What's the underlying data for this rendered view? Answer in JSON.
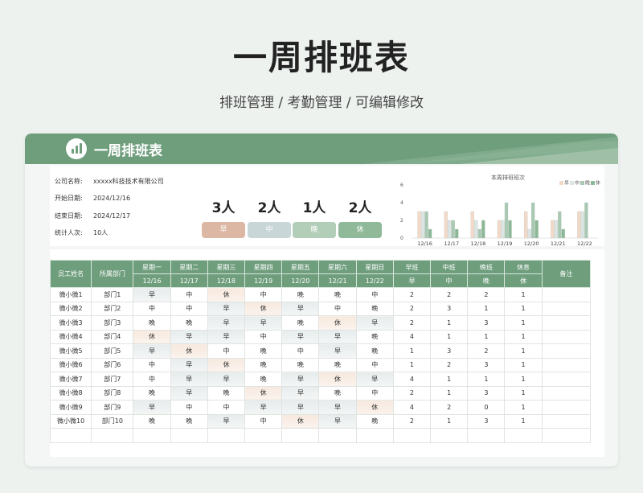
{
  "page": {
    "title": "一周排班表",
    "subtitle": "排班管理 / 考勤管理 / 可编辑修改"
  },
  "card": {
    "title": "一周排班表"
  },
  "info": {
    "company_label": "公司名称:",
    "company_value": "xxxxx科技技术有限公司",
    "start_label": "开始日期:",
    "start_value": "2024/12/16",
    "end_label": "结束日期:",
    "end_value": "2024/12/17",
    "count_label": "统计人次:",
    "count_value": "10人"
  },
  "stats": [
    {
      "value": "3人",
      "label": "早",
      "color": "#dcb7a4"
    },
    {
      "value": "2人",
      "label": "中",
      "color": "#c9d6d8"
    },
    {
      "value": "1人",
      "label": "晚",
      "color": "#b2cdb8"
    },
    {
      "value": "2人",
      "label": "休",
      "color": "#8fb999"
    }
  ],
  "chart_data": {
    "type": "bar",
    "title": "本周排班班次",
    "categories": [
      "12/16",
      "12/17",
      "12/18",
      "12/19",
      "12/20",
      "12/21",
      "12/22"
    ],
    "series": [
      {
        "name": "早",
        "color": "#f4d9c8",
        "values": [
          3,
          3,
          3,
          2,
          3,
          2,
          3
        ]
      },
      {
        "name": "中",
        "color": "#dce4e4",
        "values": [
          3,
          2,
          2,
          2,
          1,
          2,
          3
        ]
      },
      {
        "name": "晚",
        "color": "#a9c8b2",
        "values": [
          3,
          2,
          1,
          4,
          4,
          3,
          4
        ]
      },
      {
        "name": "休",
        "color": "#8db897",
        "values": [
          1,
          1,
          2,
          2,
          2,
          1,
          0
        ]
      }
    ],
    "ylim": [
      0,
      4
    ],
    "yticks": [
      0,
      2,
      4,
      6
    ],
    "legend": "top-right"
  },
  "table": {
    "headers": {
      "name": "员工姓名",
      "dept": "所属部门",
      "weekdays": [
        "星期一",
        "星期二",
        "星期三",
        "星期四",
        "星期五",
        "星期六",
        "星期日"
      ],
      "dates": [
        "12/16",
        "12/17",
        "12/18",
        "12/19",
        "12/20",
        "12/21",
        "12/22"
      ],
      "summary": [
        "早班",
        "中班",
        "晚班",
        "休息"
      ],
      "summary_sub": [
        "早",
        "中",
        "晚",
        "休"
      ],
      "note": "备注"
    },
    "rows": [
      {
        "name": "微小微1",
        "dept": "部门1",
        "shifts": [
          "早",
          "中",
          "休",
          "中",
          "晚",
          "晚",
          "中"
        ],
        "counts": [
          "2",
          "2",
          "2",
          "1"
        ],
        "note": ""
      },
      {
        "name": "微小微2",
        "dept": "部门2",
        "shifts": [
          "中",
          "中",
          "早",
          "休",
          "早",
          "中",
          "晚"
        ],
        "counts": [
          "2",
          "3",
          "1",
          "1"
        ],
        "note": ""
      },
      {
        "name": "微小微3",
        "dept": "部门3",
        "shifts": [
          "晚",
          "晚",
          "早",
          "早",
          "晚",
          "休",
          "早"
        ],
        "counts": [
          "2",
          "1",
          "3",
          "1"
        ],
        "note": ""
      },
      {
        "name": "微小微4",
        "dept": "部门4",
        "shifts": [
          "休",
          "早",
          "早",
          "中",
          "早",
          "早",
          "晚"
        ],
        "counts": [
          "4",
          "1",
          "1",
          "1"
        ],
        "note": ""
      },
      {
        "name": "微小微5",
        "dept": "部门5",
        "shifts": [
          "早",
          "休",
          "中",
          "晚",
          "中",
          "早",
          "晚"
        ],
        "counts": [
          "1",
          "3",
          "2",
          "1"
        ],
        "note": ""
      },
      {
        "name": "微小微6",
        "dept": "部门6",
        "shifts": [
          "中",
          "早",
          "休",
          "晚",
          "晚",
          "晚",
          "中"
        ],
        "counts": [
          "1",
          "2",
          "3",
          "1"
        ],
        "note": ""
      },
      {
        "name": "微小微7",
        "dept": "部门7",
        "shifts": [
          "中",
          "早",
          "早",
          "晚",
          "早",
          "休",
          "早"
        ],
        "counts": [
          "4",
          "1",
          "1",
          "1"
        ],
        "note": ""
      },
      {
        "name": "微小微8",
        "dept": "部门8",
        "shifts": [
          "晚",
          "早",
          "晚",
          "休",
          "早",
          "晚",
          "中"
        ],
        "counts": [
          "2",
          "1",
          "3",
          "1"
        ],
        "note": ""
      },
      {
        "name": "微小微9",
        "dept": "部门9",
        "shifts": [
          "早",
          "中",
          "中",
          "早",
          "早",
          "早",
          "休"
        ],
        "counts": [
          "4",
          "2",
          "0",
          "1"
        ],
        "note": ""
      },
      {
        "name": "微小微10",
        "dept": "部门10",
        "shifts": [
          "晚",
          "晚",
          "早",
          "中",
          "休",
          "早",
          "晚"
        ],
        "counts": [
          "2",
          "1",
          "3",
          "1"
        ],
        "note": ""
      },
      {
        "name": "",
        "dept": "",
        "shifts": [
          "",
          "",
          "",
          "",
          "",
          "",
          ""
        ],
        "counts": [
          "",
          "",
          "",
          ""
        ],
        "note": ""
      }
    ]
  }
}
